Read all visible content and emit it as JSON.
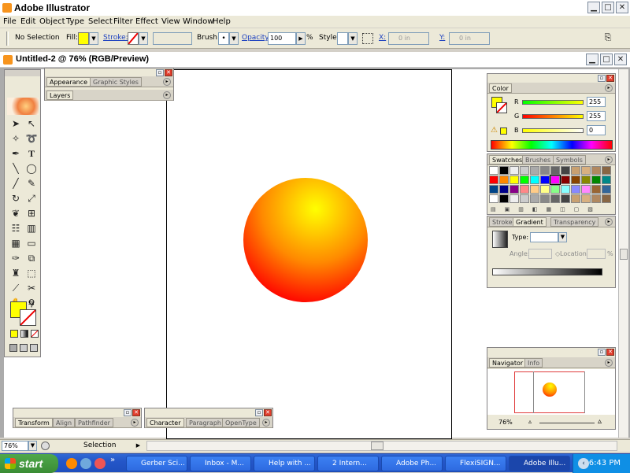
{
  "app": {
    "title": "Adobe Illustrator"
  },
  "menu": [
    "File",
    "Edit",
    "Object",
    "Type",
    "Select",
    "Filter",
    "Effect",
    "View",
    "Window",
    "Help"
  ],
  "control": {
    "selection": "No Selection",
    "fill_label": "Fill:",
    "stroke_label": "Stroke:",
    "brush_label": "Brush:",
    "opacity_label": "Opacity:",
    "opacity_value": "100",
    "opacity_unit": "%",
    "style_label": "Style:",
    "x_label": "X:",
    "x_value": "0 in",
    "y_label": "Y:",
    "y_value": "0 in",
    "fill_color": "#ffff00"
  },
  "document": {
    "title": "Untitled-2 @ 76% (RGB/Preview)"
  },
  "appearance_palette": {
    "tabs": [
      "Appearance",
      "Graphic Styles"
    ],
    "layers_tab": "Layers"
  },
  "color_palette": {
    "tab": "Color",
    "r_label": "R",
    "r_value": "255",
    "g_label": "G",
    "g_value": "255",
    "b_label": "B",
    "b_value": "0"
  },
  "swatches_palette": {
    "tabs": [
      "Swatches",
      "Brushes",
      "Symbols"
    ]
  },
  "gradient_palette": {
    "tabs": [
      "Stroke",
      "Gradient",
      "Transparency"
    ],
    "type_label": "Type:",
    "angle_label": "Angle:",
    "location_label": "Location:",
    "location_unit": "%"
  },
  "navigator": {
    "tabs": [
      "Navigator",
      "Info"
    ],
    "zoom": "76%"
  },
  "transform_palette": {
    "tabs": [
      "Transform",
      "Align",
      "Pathfinder"
    ]
  },
  "character_palette": {
    "tabs": [
      "Character",
      "Paragraph",
      "OpenType"
    ]
  },
  "status": {
    "zoom": "76%",
    "mode": "Selection"
  },
  "taskbar": {
    "start": "start",
    "items": [
      "Gerber Sci...",
      "Inbox - M...",
      "Help with ...",
      "2 Intern...",
      "Adobe Ph...",
      "FlexiSIGN...",
      "Adobe Illu..."
    ],
    "clock": "6:43 PM"
  },
  "colors": {
    "accent": "#1b3fbf",
    "circle_center": "#ffff00",
    "circle_edge": "#ff0000"
  }
}
